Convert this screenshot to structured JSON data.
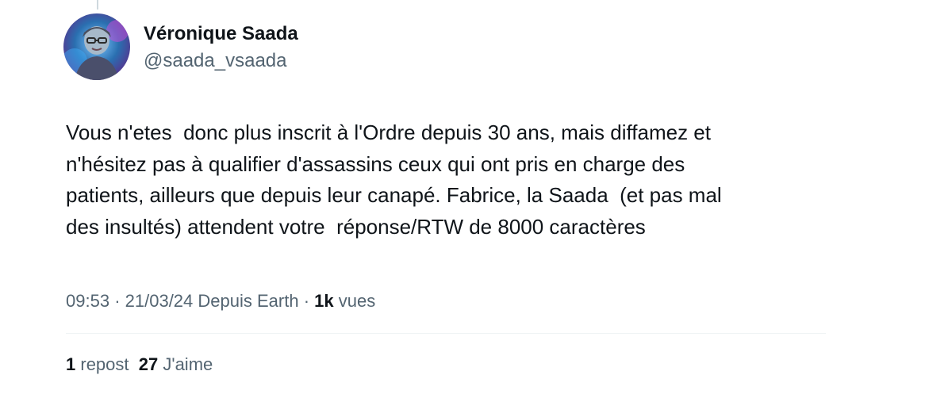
{
  "author": {
    "display_name": "Véronique Saada",
    "handle": "@saada_vsaada"
  },
  "tweet": {
    "lines": [
      "Vous n'etes  donc plus inscrit à l'Ordre depuis 30 ans, mais diffamez et",
      "n'hésitez pas à qualifier d'assassins ceux qui ont pris en charge des",
      "patients, ailleurs que depuis leur canapé. Fabrice, la Saada  (et pas mal",
      "des insultés) attendent votre  réponse/RTW de 8000 caractères"
    ]
  },
  "meta": {
    "time": "09:53",
    "separator": "·",
    "date": "21/03/24",
    "source": "Depuis Earth",
    "views_count": "1k",
    "views_label": "vues"
  },
  "stats": {
    "reposts_count": "1",
    "reposts_label": "repost",
    "likes_count": "27",
    "likes_label": "J'aime"
  },
  "colors": {
    "text_primary": "#0f1419",
    "text_secondary": "#536471",
    "divider": "#eff3f4",
    "avatar_background": "#2a6fb0"
  },
  "icons": {
    "avatar": "profile-photo"
  }
}
